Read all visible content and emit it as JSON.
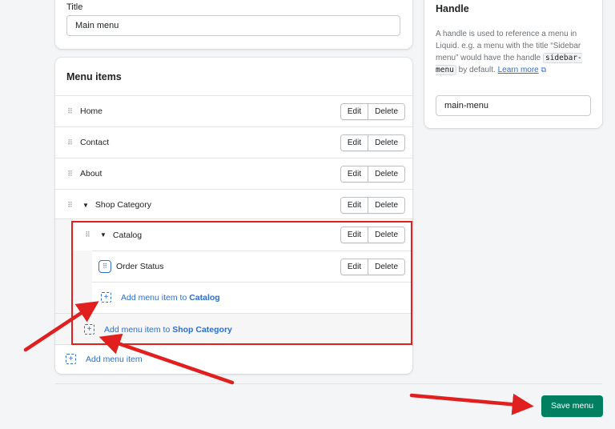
{
  "title_section": {
    "label": "Title",
    "value": "Main menu"
  },
  "handle_section": {
    "heading": "Handle",
    "desc_1": "A handle is used to reference a menu in Liquid. e.g. a menu with the title “Sidebar menu” would have the handle",
    "code": "sidebar-menu",
    "desc_2": "by default.",
    "link": "Learn more",
    "value": "main-menu"
  },
  "menu_items": {
    "heading": "Menu items",
    "edit_label": "Edit",
    "delete_label": "Delete",
    "items": [
      {
        "label": "Home"
      },
      {
        "label": "Contact"
      },
      {
        "label": "About"
      },
      {
        "label": "Shop Category"
      },
      {
        "label": "Catalog"
      },
      {
        "label": "Order Status"
      }
    ],
    "add_to_catalog": {
      "prefix": "Add menu item to",
      "target": "Catalog"
    },
    "add_to_shop": {
      "prefix": "Add menu item to",
      "target": "Shop Category"
    },
    "add_item": "Add menu item"
  },
  "footer": {
    "save_label": "Save menu"
  },
  "colors": {
    "primary": "#008060",
    "link": "#2c6ecb",
    "annotation": "#e21f1f"
  }
}
